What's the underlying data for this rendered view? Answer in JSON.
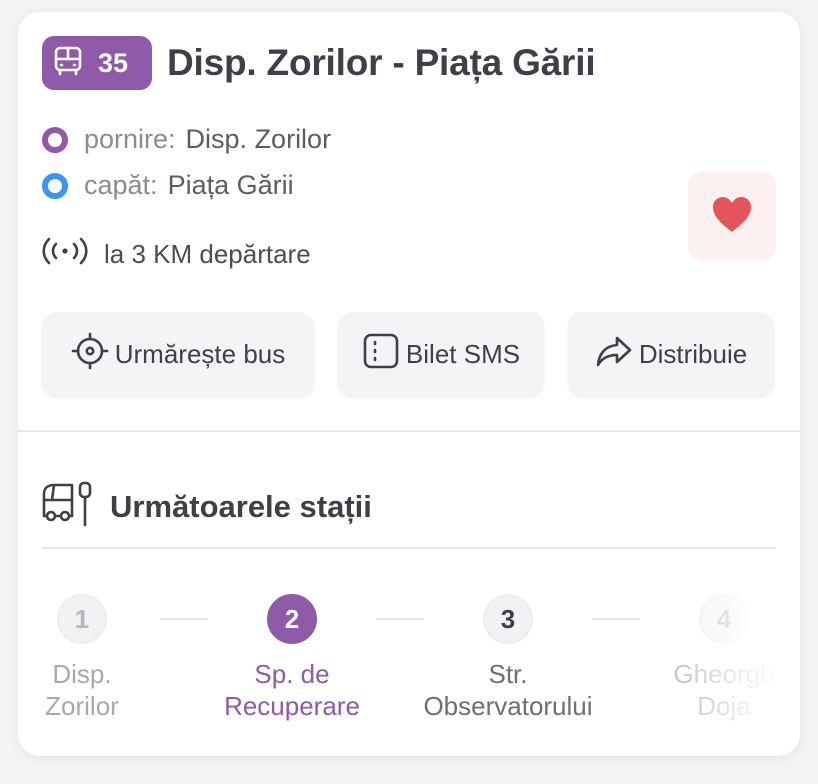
{
  "route": {
    "number": "35",
    "title": "Disp. Zorilor - Piața Gării",
    "color": "#8f5aa7"
  },
  "terminals": {
    "start": {
      "label": "pornire:",
      "value": "Disp. Zorilor"
    },
    "end": {
      "label": "capăt:",
      "value": "Piața Gării"
    }
  },
  "distance_text": "la 3 KM depărtare",
  "actions": {
    "track": "Urmărește bus",
    "sms": "Bilet SMS",
    "share": "Distribuie"
  },
  "stops": {
    "title": "Următoarele stații",
    "items": [
      {
        "num": "1",
        "line1": "Disp.",
        "line2": "Zorilor",
        "status": "past"
      },
      {
        "num": "2",
        "line1": "Sp. de",
        "line2": "Recuperare",
        "status": "current"
      },
      {
        "num": "3",
        "line1": "Str.",
        "line2": "Observatorului",
        "status": "next"
      },
      {
        "num": "4",
        "line1": "Gheorgh",
        "line2": "Doja",
        "status": "upcoming"
      }
    ]
  },
  "icons": {
    "badge": "bus-icon",
    "distance": "signal-broadcast-icon",
    "favorite": "heart-icon",
    "track": "crosshair-icon",
    "sms": "ticket-icon",
    "share": "share-arrow-icon",
    "stops": "bus-stop-icon"
  },
  "colors": {
    "accent": "#8f5aa7",
    "end_terminal": "#3b95f0",
    "favorite": "#e5545c"
  }
}
